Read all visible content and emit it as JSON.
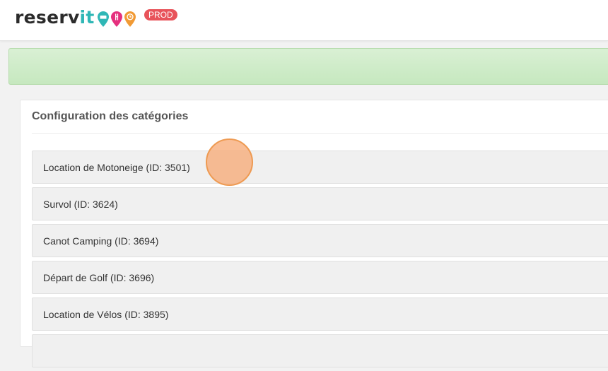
{
  "header": {
    "logo": {
      "text_main": "reserv",
      "text_accent": "it"
    },
    "pins": [
      {
        "icon": "bed-icon",
        "color": "#2fb7b6"
      },
      {
        "icon": "fork-knife-icon",
        "color": "#e5307e"
      },
      {
        "icon": "clock-icon",
        "color": "#f19a35"
      }
    ],
    "env_badge": "PROD"
  },
  "panel": {
    "title": "Configuration des catégories",
    "categories": [
      {
        "label": "Location de Motoneige (ID: 3501)"
      },
      {
        "label": "Survol (ID: 3624)"
      },
      {
        "label": "Canot Camping (ID: 3694)"
      },
      {
        "label": "Départ de Golf (ID: 3696)"
      },
      {
        "label": "Location de Vélos (ID: 3895)"
      },
      {
        "label": ""
      }
    ]
  },
  "colors": {
    "accent": "#2fb7b6",
    "badge": "#e8535a",
    "alert_bg": "#cdeac6"
  }
}
